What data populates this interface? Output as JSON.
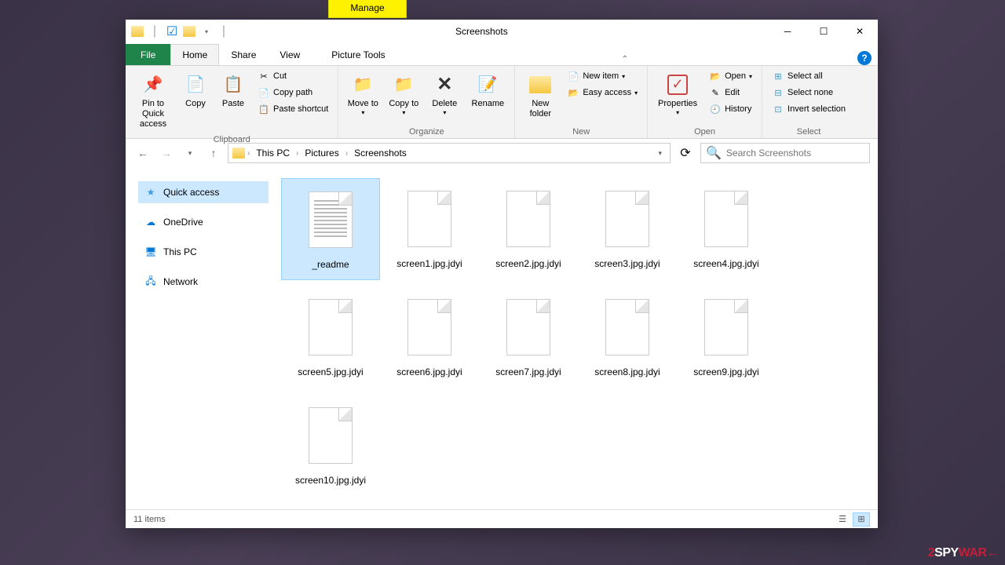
{
  "window": {
    "title": "Screenshots"
  },
  "context_tab": {
    "header": "Manage",
    "label": "Picture Tools"
  },
  "tabs": {
    "file": "File",
    "home": "Home",
    "share": "Share",
    "view": "View"
  },
  "ribbon": {
    "clipboard": {
      "label": "Clipboard",
      "pin": "Pin to Quick access",
      "copy": "Copy",
      "paste": "Paste",
      "cut": "Cut",
      "copy_path": "Copy path",
      "paste_shortcut": "Paste shortcut"
    },
    "organize": {
      "label": "Organize",
      "move_to": "Move to",
      "copy_to": "Copy to",
      "delete": "Delete",
      "rename": "Rename"
    },
    "new": {
      "label": "New",
      "new_folder": "New folder",
      "new_item": "New item",
      "easy_access": "Easy access"
    },
    "open": {
      "label": "Open",
      "properties": "Properties",
      "open": "Open",
      "edit": "Edit",
      "history": "History"
    },
    "select": {
      "label": "Select",
      "select_all": "Select all",
      "select_none": "Select none",
      "invert": "Invert selection"
    }
  },
  "breadcrumbs": [
    "This PC",
    "Pictures",
    "Screenshots"
  ],
  "search": {
    "placeholder": "Search Screenshots"
  },
  "nav_pane": {
    "quick_access": "Quick access",
    "onedrive": "OneDrive",
    "this_pc": "This PC",
    "network": "Network"
  },
  "files": [
    {
      "name": "_readme",
      "type": "text",
      "selected": true
    },
    {
      "name": "screen1.jpg.jdyi",
      "type": "blank"
    },
    {
      "name": "screen2.jpg.jdyi",
      "type": "blank"
    },
    {
      "name": "screen3.jpg.jdyi",
      "type": "blank"
    },
    {
      "name": "screen4.jpg.jdyi",
      "type": "blank"
    },
    {
      "name": "screen5.jpg.jdyi",
      "type": "blank"
    },
    {
      "name": "screen6.jpg.jdyi",
      "type": "blank"
    },
    {
      "name": "screen7.jpg.jdyi",
      "type": "blank"
    },
    {
      "name": "screen8.jpg.jdyi",
      "type": "blank"
    },
    {
      "name": "screen9.jpg.jdyi",
      "type": "blank"
    },
    {
      "name": "screen10.jpg.jdyi",
      "type": "blank"
    }
  ],
  "status": {
    "items": "11 items"
  },
  "watermark": {
    "prefix": "2",
    "middle": "SPY",
    "suffix": "WAR←"
  }
}
